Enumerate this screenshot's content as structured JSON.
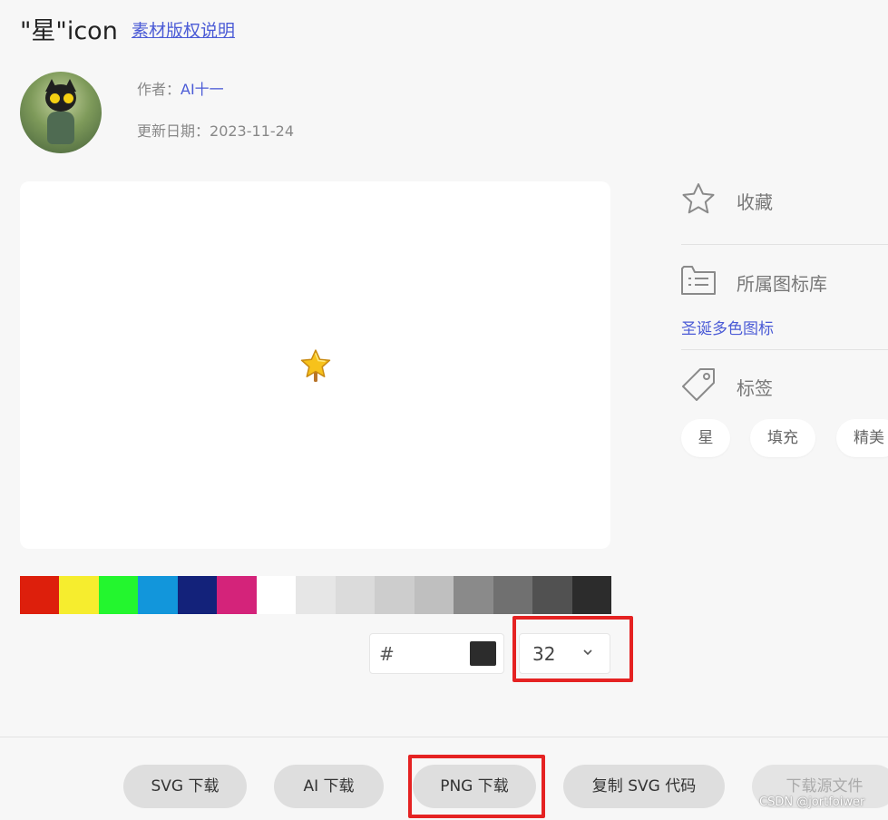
{
  "header": {
    "title": "\"星\"icon",
    "copyright_link": "素材版权说明"
  },
  "meta": {
    "author_label": "作者：",
    "author_name": "AI十一",
    "date_label": "更新日期：",
    "date_value": "2023-11-24"
  },
  "preview": {
    "icon": "star-icon"
  },
  "palette": {
    "swatches": [
      "#dd1f0c",
      "#f6ed2e",
      "#23f62e",
      "#1296db",
      "#13227a",
      "#d4237a",
      "#ffffff",
      "#e6e6e6",
      "#dbdbdb",
      "#cdcdcd",
      "#bfbfbf",
      "#8a8a8a",
      "#707070",
      "#515151",
      "#2c2c2c"
    ]
  },
  "color_input": {
    "prefix": "#",
    "current_color": "#2c2c2c"
  },
  "size_select": {
    "value": "32"
  },
  "sidebar": {
    "favorite_label": "收藏",
    "library_label": "所属图标库",
    "library_link": "圣诞多色图标",
    "tags_label": "标签",
    "tags": [
      "星",
      "填充",
      "精美"
    ]
  },
  "footer": {
    "svg_download": "SVG 下载",
    "ai_download": "AI 下载",
    "png_download": "PNG 下载",
    "copy_svg": "复制 SVG 代码",
    "source_download": "下载源文件"
  },
  "watermark": "CSDN @jortfoiwer",
  "colors": {
    "accent_link": "#4b5bd6",
    "annotation_red": "#e52222"
  }
}
